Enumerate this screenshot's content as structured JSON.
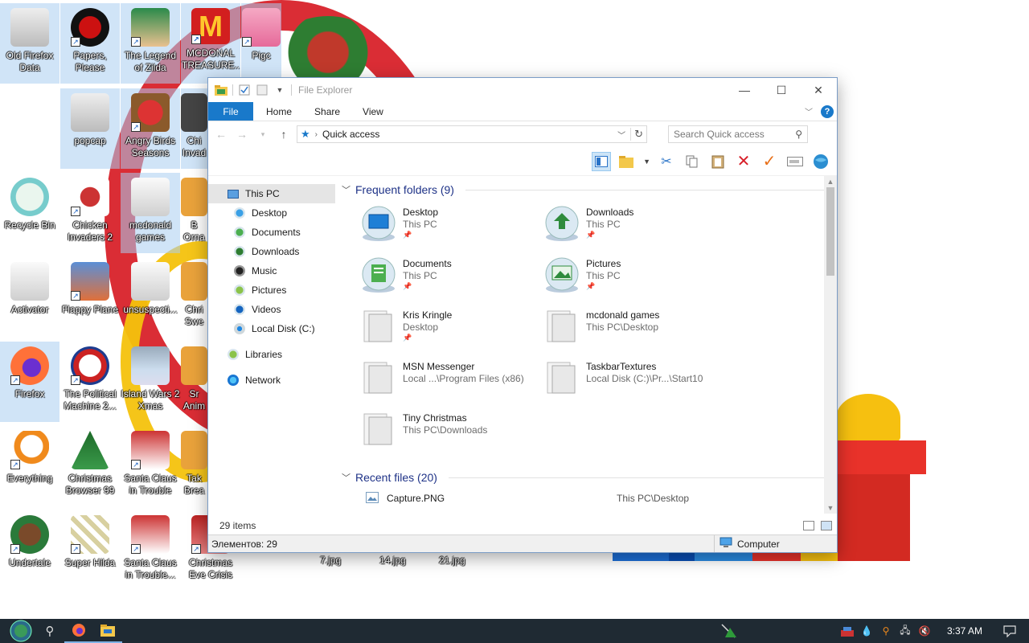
{
  "desktop": {
    "icons": [
      {
        "label": "Old Firefox Data"
      },
      {
        "label": "Papers, Please"
      },
      {
        "label": "The Legend of Zilda"
      },
      {
        "label": "MCDONAL TREASURE..."
      },
      {
        "label": "Pigc"
      },
      {
        "label": "popcap"
      },
      {
        "label": "Angry Birds Seasons"
      },
      {
        "label": "Chi Invad"
      },
      {
        "label": "Recycle Bin"
      },
      {
        "label": "Chicken Invaders 2"
      },
      {
        "label": "mcdonald games"
      },
      {
        "label": "B Orna"
      },
      {
        "label": "Activator"
      },
      {
        "label": "Flappy Plane"
      },
      {
        "label": "unsuspecti..."
      },
      {
        "label": "Chri Swe"
      },
      {
        "label": "Firefox"
      },
      {
        "label": "The Political Machine 2..."
      },
      {
        "label": "Island Wars 2 Xmas"
      },
      {
        "label": "Sr Anim"
      },
      {
        "label": "Everything"
      },
      {
        "label": "Christmas Browser 99"
      },
      {
        "label": "Santa Claus in Trouble"
      },
      {
        "label": "Tak Brea"
      },
      {
        "label": "Undertale"
      },
      {
        "label": "Super Hilda"
      },
      {
        "label": "Santa Claus in Trouble..."
      },
      {
        "label": "Christmas Eve Crisis"
      }
    ],
    "loose_labels": [
      "7.jpg",
      "14.jpg",
      "21.jpg"
    ]
  },
  "explorer": {
    "title": "File Explorer",
    "tabs": {
      "file": "File",
      "home": "Home",
      "share": "Share",
      "view": "View"
    },
    "address": {
      "path": "Quick access"
    },
    "search": {
      "placeholder": "Search Quick access"
    },
    "nav": {
      "this_pc": "This PC",
      "desktop": "Desktop",
      "documents": "Documents",
      "downloads": "Downloads",
      "music": "Music",
      "pictures": "Pictures",
      "videos": "Videos",
      "local_disk": "Local Disk (C:)",
      "libraries": "Libraries",
      "network": "Network"
    },
    "frequent": {
      "header": "Frequent folders (9)",
      "folders": [
        {
          "name": "Desktop",
          "location": "This PC"
        },
        {
          "name": "Downloads",
          "location": "This PC"
        },
        {
          "name": "Documents",
          "location": "This PC"
        },
        {
          "name": "Pictures",
          "location": "This PC"
        },
        {
          "name": "Kris Kringle",
          "location": "Desktop"
        },
        {
          "name": "mcdonald games",
          "location": "This PC\\Desktop"
        },
        {
          "name": "MSN Messenger",
          "location": "Local ...\\Program Files (x86)"
        },
        {
          "name": "TaskbarTextures",
          "location": "Local Disk (C:)\\Pr...\\Start10"
        },
        {
          "name": "Tiny Christmas",
          "location": "This PC\\Downloads"
        }
      ]
    },
    "recent": {
      "header": "Recent files (20)",
      "files": [
        {
          "name": "Capture.PNG",
          "location": "This PC\\Desktop"
        }
      ]
    },
    "status": {
      "items": "29 items",
      "elements": "Элементов: 29",
      "computer": "Computer"
    }
  },
  "taskbar": {
    "clock": "3:37 AM"
  },
  "colors": {
    "accent": "#1979ca",
    "section_header": "#1e3287",
    "taskbar": "#1f2a33"
  }
}
